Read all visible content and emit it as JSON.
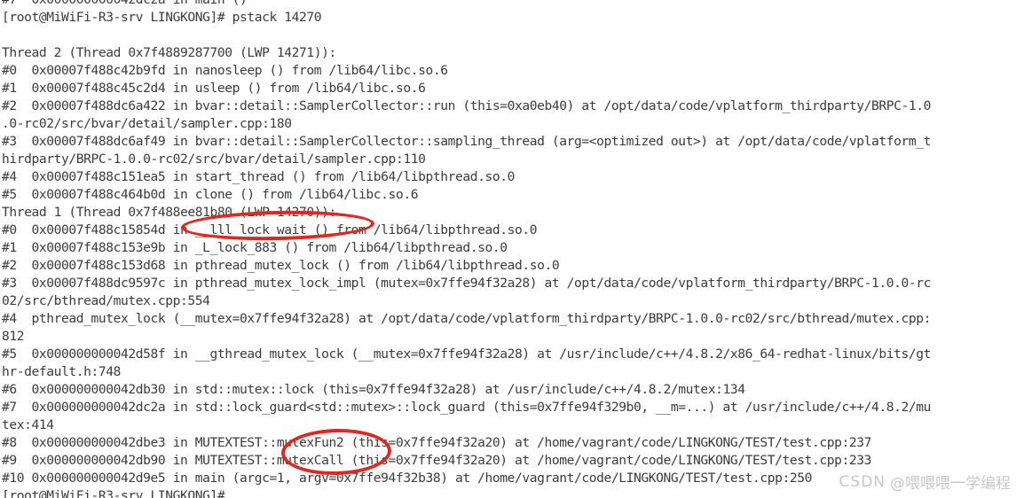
{
  "terminal": {
    "prompt": "[root@MiWiFi-R3-srv LINGKONG]#",
    "command": "pstack 14270",
    "colors": {
      "background": "#ffffff",
      "text": "#3b3b3b",
      "annotation": "#e8241d",
      "watermark": "#c8c8c8"
    },
    "lines": [
      "#7  0x000000000042dc2a in main ()",
      "[root@MiWiFi-R3-srv LINGKONG]# pstack 14270",
      "",
      "Thread 2 (Thread 0x7f4889287700 (LWP 14271)):",
      "#0  0x00007f488c42b9fd in nanosleep () from /lib64/libc.so.6",
      "#1  0x00007f488c45c2d4 in usleep () from /lib64/libc.so.6",
      "#2  0x00007f488dc6a422 in bvar::detail::SamplerCollector::run (this=0xa0eb40) at /opt/data/code/vplatform_thirdparty/BRPC-1.0",
      ".0-rc02/src/bvar/detail/sampler.cpp:180",
      "#3  0x00007f488dc6af49 in bvar::detail::SamplerCollector::sampling_thread (arg=<optimized out>) at /opt/data/code/vplatform_t",
      "hirdparty/BRPC-1.0.0-rc02/src/bvar/detail/sampler.cpp:110",
      "#4  0x00007f488c151ea5 in start_thread () from /lib64/libpthread.so.0",
      "#5  0x00007f488c464b0d in clone () from /lib64/libc.so.6",
      "Thread 1 (Thread 0x7f488ee81b80 (LWP 14270)):",
      "#0  0x00007f488c15854d in __lll_lock_wait () from /lib64/libpthread.so.0",
      "#1  0x00007f488c153e9b in _L_lock_883 () from /lib64/libpthread.so.0",
      "#2  0x00007f488c153d68 in pthread_mutex_lock () from /lib64/libpthread.so.0",
      "#3  0x00007f488dc9597c in pthread_mutex_lock_impl (mutex=0x7ffe94f32a28) at /opt/data/code/vplatform_thirdparty/BRPC-1.0.0-rc",
      "02/src/bthread/mutex.cpp:554",
      "#4  pthread_mutex_lock (__mutex=0x7ffe94f32a28) at /opt/data/code/vplatform_thirdparty/BRPC-1.0.0-rc02/src/bthread/mutex.cpp:",
      "812",
      "#5  0x000000000042d58f in __gthread_mutex_lock (__mutex=0x7ffe94f32a28) at /usr/include/c++/4.8.2/x86_64-redhat-linux/bits/gt",
      "hr-default.h:748",
      "#6  0x000000000042db30 in std::mutex::lock (this=0x7ffe94f32a28) at /usr/include/c++/4.8.2/mutex:134",
      "#7  0x000000000042dc2a in std::lock_guard<std::mutex>::lock_guard (this=0x7ffe94f329b0, __m=...) at /usr/include/c++/4.8.2/mu",
      "tex:414",
      "#8  0x000000000042dbe3 in MUTEXTEST::mutexFun2 (this=0x7ffe94f32a20) at /home/vagrant/code/LINGKONG/TEST/test.cpp:237",
      "#9  0x000000000042db90 in MUTEXTEST::mutexCall (this=0x7ffe94f32a20) at /home/vagrant/code/LINGKONG/TEST/test.cpp:233",
      "#10 0x000000000042d9e5 in main (argc=1, argv=0x7ffe94f32b38) at /home/vagrant/code/LINGKONG/TEST/test.cpp:250",
      "[root@MiWiFi-R3-srv LINGKONG]#"
    ],
    "annotations": [
      {
        "id": "annot-1",
        "shape": "ellipse",
        "target_text": "__lll_lock_wait ()",
        "line_index": 13
      },
      {
        "id": "annot-2",
        "shape": "ellipse",
        "target_text": "::mutexFun2 / ::mutexCall",
        "line_index": 25
      }
    ]
  },
  "watermark": {
    "brand": "CSDN",
    "user": "@喂喂喂一学编程"
  }
}
